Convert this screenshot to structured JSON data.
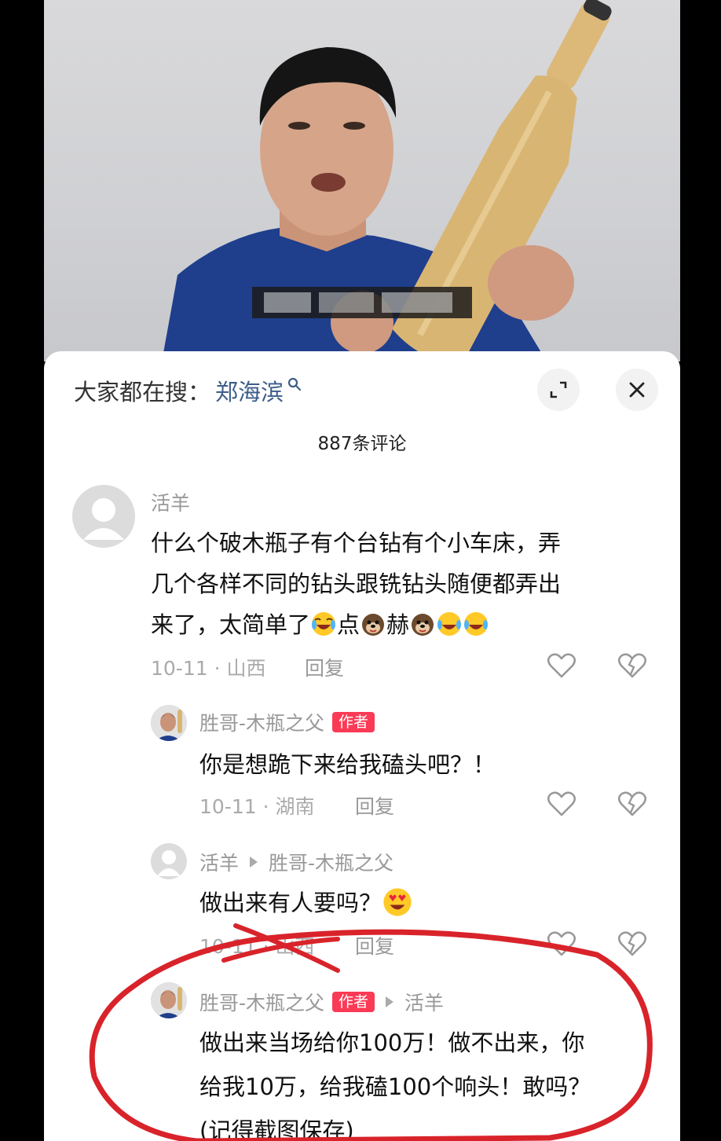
{
  "video": {
    "caption_blurred": "",
    "icon": "person-holding-wooden-bottle"
  },
  "panel": {
    "search_prefix": "大家都在搜：",
    "search_term": "郑海滨",
    "comment_count": "887条评论",
    "expand_icon": "expand-icon",
    "close_icon": "close-icon"
  },
  "comments": [
    {
      "user": "活羊",
      "text_lines": [
        "什么个破木瓶子有个台钻有个小车床，弄",
        "几个各样不同的钻头跟铣钻头随便都弄出",
        "来了，太简单了"
      ],
      "emoji_text_1": "点",
      "emoji_text_2": "赫",
      "date": "10-11",
      "location": "山西",
      "reply_label": "回复"
    },
    {
      "user": "胜哥-木瓶之父",
      "badge": "作者",
      "text": "你是想跪下来给我磕头吧？！",
      "date": "10-11",
      "location": "湖南",
      "reply_label": "回复"
    },
    {
      "user": "活羊",
      "reply_to": "胜哥-木瓶之父",
      "text": "做出来有人要吗？",
      "date": "10-11",
      "location": "山西",
      "reply_label": "回复"
    },
    {
      "user": "胜哥-木瓶之父",
      "badge": "作者",
      "reply_to": "活羊",
      "text_lines": [
        "做出来当场给你100万！做不出来，你",
        "给我10万，给我磕100个响头！敢吗？",
        "(记得截图保存)"
      ]
    }
  ],
  "colors": {
    "author_badge": "#fb3a55",
    "search_term": "#3c5d8a",
    "annotation_circle": "#d9232a"
  }
}
